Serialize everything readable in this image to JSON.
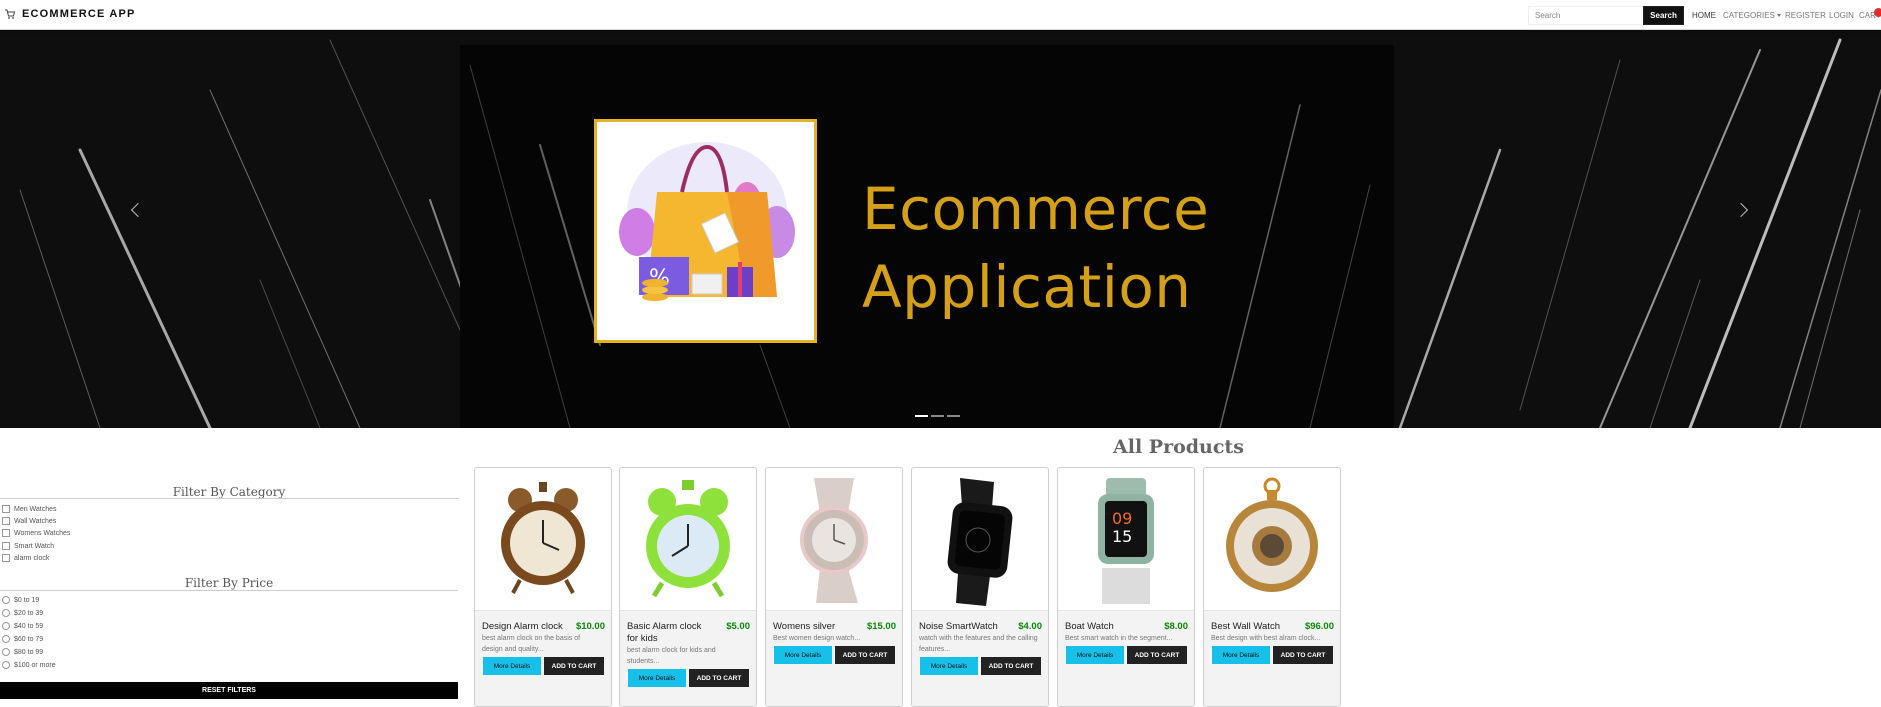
{
  "navbar": {
    "brand": "ECOMMERCE APP",
    "search_placeholder": "Search",
    "search_button": "Search",
    "links": {
      "home": "HOME",
      "categories": "CATEGORIES",
      "register": "REGISTER",
      "login": "LOGIN",
      "cart": "CART"
    }
  },
  "hero": {
    "title_line1": "Ecommerce",
    "title_line2": "Application",
    "slide_count": 3,
    "active_slide": 1
  },
  "filters": {
    "category_title": "Filter By Category",
    "categories": [
      "Men Watches",
      "Wall Watches",
      "Womens Watches",
      "Smart Watch",
      "alarm clock"
    ],
    "price_title": "Filter By Price",
    "prices": [
      "$0 to 19",
      "$20 to 39",
      "$40 to 59",
      "$60 to 79",
      "$80 to 99",
      "$100 or more"
    ],
    "reset_label": "RESET FILTERS"
  },
  "products": {
    "title": "All Products",
    "more_details_label": "More Details",
    "add_to_cart_label": "ADD TO CART",
    "items": [
      {
        "name": "Design Alarm clock",
        "price": "$10.00",
        "description": "best alarm clock on the basis of design and quality...",
        "image_icon": "alarm-clock-brown-icon"
      },
      {
        "name": "Basic Alarm clock for kids",
        "price": "$5.00",
        "description": "best alarm clock for kids and students...",
        "image_icon": "alarm-clock-green-icon"
      },
      {
        "name": "Womens silver",
        "price": "$15.00",
        "description": "Best women design watch...",
        "image_icon": "silver-watch-icon"
      },
      {
        "name": "Noise SmartWatch",
        "price": "$4.00",
        "description": "watch with the features and the calling features...",
        "image_icon": "smartwatch-black-icon"
      },
      {
        "name": "Boat Watch",
        "price": "$8.00",
        "description": "Best smart watch in the segment...",
        "image_icon": "smartwatch-green-icon"
      },
      {
        "name": "Best Wall Watch",
        "price": "$96.00",
        "description": "Best design with best alram clock...",
        "image_icon": "pocket-watch-icon"
      }
    ]
  },
  "colors": {
    "brand_gold": "#d4a017",
    "price_green": "#0a8a0a",
    "details_button": "#17c0e8",
    "cart_badge": "#e12b2b"
  }
}
